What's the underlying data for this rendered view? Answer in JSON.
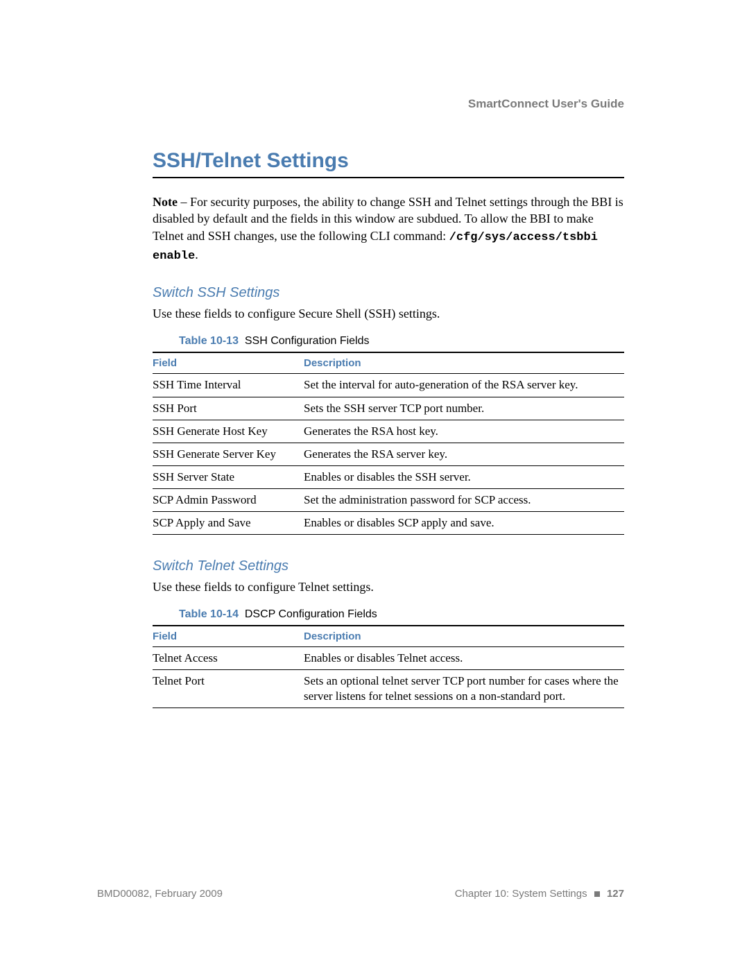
{
  "header": {
    "guide": "SmartConnect User's Guide"
  },
  "title": "SSH/Telnet Settings",
  "note": {
    "label": "Note",
    "text_before": " – For security purposes, the ability to change SSH and Telnet settings through the BBI is disabled by default and the fields in this window are subdued. To allow the BBI to make Telnet and SSH changes, use the following CLI command: ",
    "code": "/cfg/sys/access/tsbbi enable",
    "text_after": "."
  },
  "ssh": {
    "heading": "Switch SSH Settings",
    "lead": "Use these fields to configure Secure Shell (SSH) settings.",
    "caption_num": "Table 10-13",
    "caption_title": "SSH Configuration Fields",
    "col_field": "Field",
    "col_desc": "Description",
    "rows": [
      {
        "field": "SSH Time Interval",
        "desc": "Set the interval for auto-generation of the RSA server key."
      },
      {
        "field": "SSH Port",
        "desc": "Sets the SSH server TCP port number."
      },
      {
        "field": "SSH Generate Host Key",
        "desc": "Generates the RSA host key."
      },
      {
        "field": "SSH Generate Server Key",
        "desc": "Generates the RSA server key."
      },
      {
        "field": "SSH Server State",
        "desc": "Enables or disables the SSH server."
      },
      {
        "field": "SCP Admin Password",
        "desc": "Set the administration password for SCP access."
      },
      {
        "field": "SCP Apply and Save",
        "desc": "Enables or disables SCP apply and save."
      }
    ]
  },
  "telnet": {
    "heading": "Switch Telnet Settings",
    "lead": "Use these fields to configure Telnet settings.",
    "caption_num": "Table 10-14",
    "caption_title": "DSCP Configuration Fields",
    "col_field": "Field",
    "col_desc": "Description",
    "rows": [
      {
        "field": "Telnet Access",
        "desc": "Enables or disables Telnet access."
      },
      {
        "field": "Telnet Port",
        "desc": "Sets an optional telnet server TCP port number for cases where the server listens for telnet sessions on a non-standard port."
      }
    ]
  },
  "footer": {
    "left": "BMD00082, February 2009",
    "chapter": "Chapter 10: System Settings",
    "page": "127"
  }
}
